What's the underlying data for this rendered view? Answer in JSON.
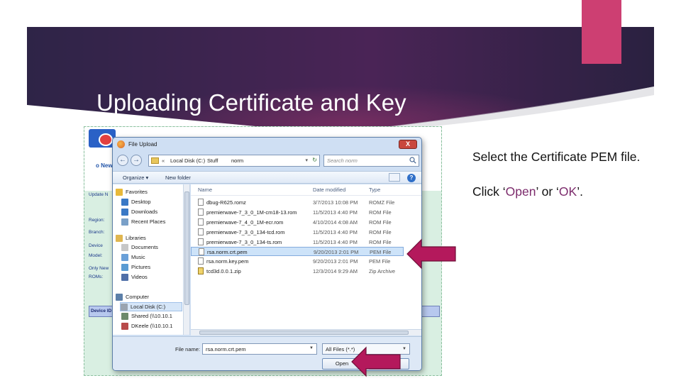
{
  "slide": {
    "title": "Uploading Certificate and Key",
    "colors": {
      "banner": "#3b1f52",
      "accent": "#cd3f72",
      "arrow": "#b4195c",
      "highlight_text": "#7c2b6c"
    }
  },
  "instructions": {
    "line1": "Select the Certificate PEM file.",
    "line2_prefix": "Click ‘",
    "open_word": "Open",
    "line2_middle": "’ or ‘",
    "ok_word": "OK",
    "line2_suffix": "’."
  },
  "background_page": {
    "new_link": "o New",
    "labels": [
      "Update N",
      "Region:",
      "Branch:",
      "Device",
      "Model:",
      "Only New",
      "ROMs:"
    ],
    "strip_label": "Device ID"
  },
  "dialog": {
    "title": "File Upload",
    "close_label": "X",
    "address": {
      "path": [
        "«",
        "Local Disk (C:)",
        "Stuff",
        "norm"
      ],
      "dropdown": "▾",
      "refresh_icon": "refresh-icon"
    },
    "search_placeholder": "Search norm",
    "toolbar": {
      "organize": "Organize ▾",
      "new_folder": "New folder",
      "help": "?"
    },
    "nav_pane": [
      {
        "label": "Favorites",
        "icon": "star-icon",
        "color": "#e8b93a"
      },
      {
        "label": "Desktop",
        "icon": "desktop-icon",
        "color": "#3a79c6"
      },
      {
        "label": "Downloads",
        "icon": "downloads-icon",
        "color": "#3a79c6"
      },
      {
        "label": "Recent Places",
        "icon": "recent-places-icon",
        "color": "#7aa0c8"
      },
      {
        "label": "Libraries",
        "icon": "libraries-icon",
        "color": "#e0b650"
      },
      {
        "label": "Documents",
        "icon": "documents-icon",
        "color": "#c7c7c7"
      },
      {
        "label": "Music",
        "icon": "music-icon",
        "color": "#6aa0d8"
      },
      {
        "label": "Pictures",
        "icon": "pictures-icon",
        "color": "#5a9bd3"
      },
      {
        "label": "Videos",
        "icon": "videos-icon",
        "color": "#4f6fa8"
      },
      {
        "label": "Computer",
        "icon": "computer-icon",
        "color": "#5c7fa8"
      },
      {
        "label": "Local Disk (C:)",
        "icon": "local-disk-icon",
        "color": "#9aa4b0"
      },
      {
        "label": "Shared (\\\\10.10.1",
        "icon": "network-drive-icon",
        "color": "#6c8a6c"
      },
      {
        "label": "DKeele (\\\\10.10.1",
        "icon": "network-drive-icon",
        "color": "#b84a4a"
      }
    ],
    "columns": {
      "name": "Name",
      "date": "Date modified",
      "type": "Type"
    },
    "files": [
      {
        "name": "dbug-R625.romz",
        "date": "3/7/2013 10:08 PM",
        "type": "ROMZ File"
      },
      {
        "name": "premierwave-7_3_0_1M-cm18-13.rom",
        "date": "11/5/2013 4:40 PM",
        "type": "ROM File"
      },
      {
        "name": "premierwave-7_4_0_1M-ecr.rom",
        "date": "4/10/2014 4:08 AM",
        "type": "ROM File"
      },
      {
        "name": "premierwave-7_3_0_134-tcd.rom",
        "date": "11/5/2013 4:40 PM",
        "type": "ROM File"
      },
      {
        "name": "premierwave-7_3_0_134-ts.rom",
        "date": "11/5/2013 4:40 PM",
        "type": "ROM File"
      },
      {
        "name": "rsa.norm.crt.pem",
        "date": "9/20/2013 2:01 PM",
        "type": "PEM File"
      },
      {
        "name": "rsa.norm.key.pem",
        "date": "9/20/2013 2:01 PM",
        "type": "PEM File"
      },
      {
        "name": "tcd3d.0.0.1.zip",
        "date": "12/3/2014 9:29 AM",
        "type": "Zip Archive"
      }
    ],
    "selected_file_index": 5,
    "file_name_label": "File name:",
    "file_name_value": "rsa.norm.crt.pem",
    "filter_value": "All Files (*.*)",
    "open_label": "Open",
    "cancel_label": "Cancel"
  }
}
